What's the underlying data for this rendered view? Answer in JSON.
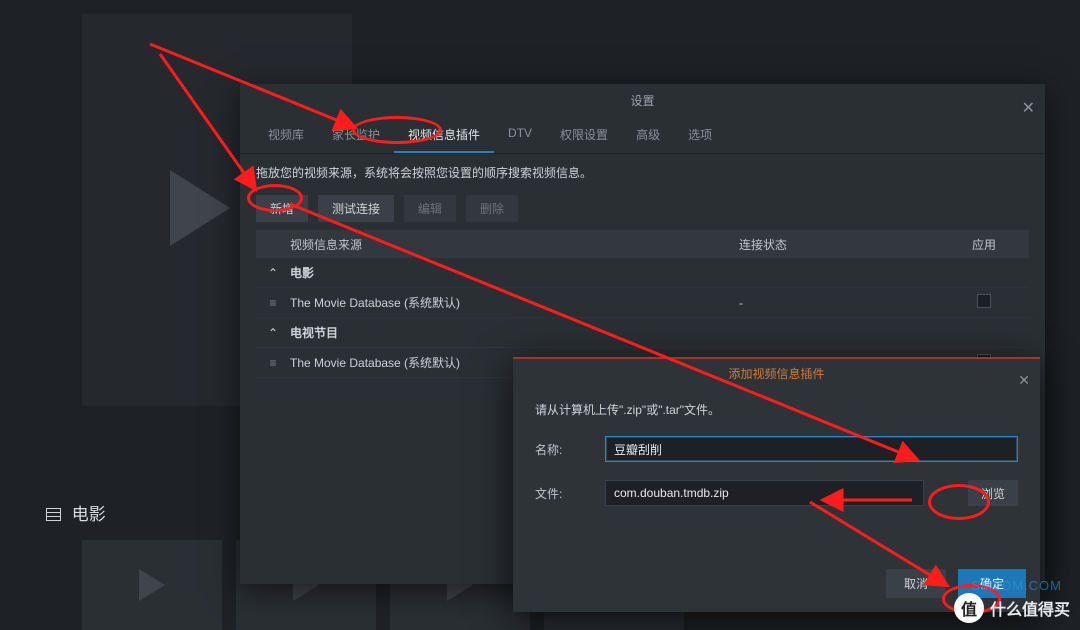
{
  "background": {
    "section_label": "电影"
  },
  "settings": {
    "title": "设置",
    "tabs": [
      "视频库",
      "家长监护",
      "视频信息插件",
      "DTV",
      "权限设置",
      "高级",
      "选项"
    ],
    "active_tab_index": 2,
    "description": "拖放您的视频来源，系统将会按照您设置的顺序搜索视频信息。",
    "buttons": {
      "add": "新增",
      "test": "测试连接",
      "edit": "编辑",
      "delete": "删除"
    },
    "columns": {
      "source": "视频信息来源",
      "status": "连接状态",
      "app": "应用"
    },
    "groups": [
      {
        "name": "电影",
        "rows": [
          {
            "source": "The Movie Database (系统默认)",
            "status": "-"
          }
        ]
      },
      {
        "name": "电视节目",
        "rows": [
          {
            "source": "The Movie Database (系统默认)",
            "status": "-"
          }
        ]
      }
    ]
  },
  "sub": {
    "title": "添加视频信息插件",
    "instruction": "请从计算机上传\".zip\"或\".tar\"文件。",
    "labels": {
      "name": "名称:",
      "file": "文件:"
    },
    "name_value": "豆瓣刮削",
    "file_value": "com.douban.tmdb.zip",
    "browse": "浏览",
    "cancel": "取消",
    "ok": "确定"
  },
  "watermark": {
    "circle": "值",
    "text": "什么值得买",
    "sub": "SMZDM.COM"
  }
}
